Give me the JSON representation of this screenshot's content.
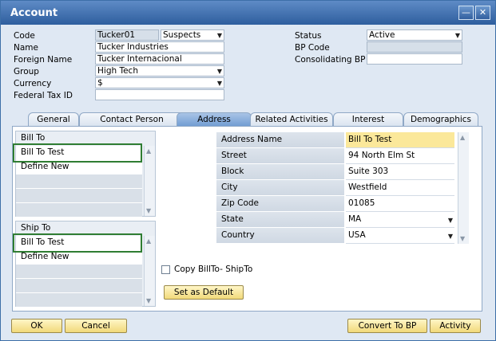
{
  "window": {
    "title": "Account",
    "minimize_icon": "minimize-icon",
    "close_icon": "close-icon"
  },
  "header": {
    "code_label": "Code",
    "code_value": "Tucker01",
    "code_type": "Suspects",
    "name_label": "Name",
    "name_value": "Tucker Industries",
    "foreign_name_label": "Foreign Name",
    "foreign_name_value": "Tucker Internacional",
    "group_label": "Group",
    "group_value": "High Tech",
    "currency_label": "Currency",
    "currency_value": "$",
    "federal_tax_label": "Federal Tax ID",
    "federal_tax_value": "",
    "status_label": "Status",
    "status_value": "Active",
    "bp_code_label": "BP Code",
    "bp_code_value": "",
    "consolidating_label": "Consolidating BP",
    "consolidating_value": ""
  },
  "tabs": [
    {
      "label": "General"
    },
    {
      "label": "Contact Person"
    },
    {
      "label": "Address"
    },
    {
      "label": "Related Activities"
    },
    {
      "label": "Interest"
    },
    {
      "label": "Demographics"
    }
  ],
  "bill_to": {
    "header": "Bill To",
    "items": [
      "Bill To Test",
      "Define New"
    ]
  },
  "ship_to": {
    "header": "Ship To",
    "items": [
      "Bill To Test",
      "Define New"
    ]
  },
  "address_fields": [
    {
      "name": "Address Name",
      "value": "Bill To Test"
    },
    {
      "name": "Street",
      "value": "94 North Elm St"
    },
    {
      "name": "Block",
      "value": "Suite 303"
    },
    {
      "name": "City",
      "value": "Westfield"
    },
    {
      "name": "Zip Code",
      "value": "01085"
    },
    {
      "name": "State",
      "value": "MA"
    },
    {
      "name": "Country",
      "value": "USA"
    }
  ],
  "copy_checkbox_label": "Copy BillTo- ShipTo",
  "set_default_label": "Set as Default",
  "footer": {
    "ok": "OK",
    "cancel": "Cancel",
    "convert": "Convert To BP",
    "activity": "Activity"
  }
}
